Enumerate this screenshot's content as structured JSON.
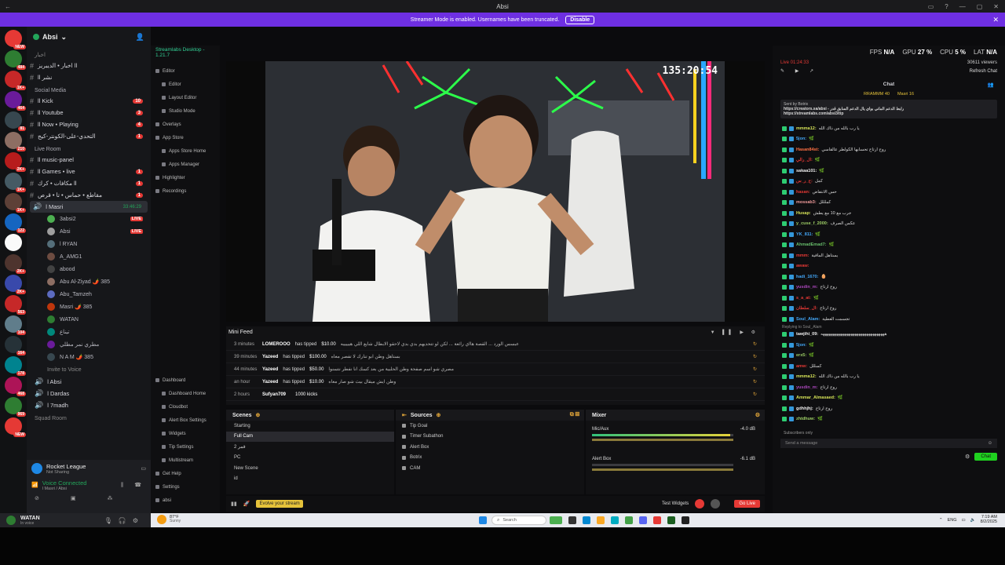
{
  "window": {
    "title": "Absi"
  },
  "banner": {
    "text": "Streamer Mode is enabled. Usernames have been truncated.",
    "button": "Disable"
  },
  "discord": {
    "server_name": "Absi",
    "servers": [
      {
        "color": "#e53935",
        "badge": "NEW"
      },
      {
        "color": "#2e7d32",
        "badge": "484"
      },
      {
        "color": "#c62828",
        "badge": "1K+"
      },
      {
        "color": "#6a1b9a",
        "badge": "464"
      },
      {
        "color": "#37474f",
        "badge": "81"
      },
      {
        "color": "#8d6e63",
        "badge": "210"
      },
      {
        "color": "#b71c1c",
        "badge": "2K+"
      },
      {
        "color": "#455a64",
        "badge": "1K+"
      },
      {
        "color": "#5d4037",
        "badge": "1K+"
      },
      {
        "color": "#1565c0",
        "badge": "122"
      },
      {
        "color": "#fafafa",
        "badge": ""
      },
      {
        "color": "#4e342e",
        "badge": "2K+"
      },
      {
        "color": "#3949ab",
        "badge": "2K+"
      },
      {
        "color": "#c62828",
        "badge": "563"
      },
      {
        "color": "#607d8b",
        "badge": "104"
      },
      {
        "color": "#263238",
        "badge": "164"
      },
      {
        "color": "#00838f",
        "badge": "178"
      },
      {
        "color": "#ad1457",
        "badge": "468"
      },
      {
        "color": "#2e7d32",
        "badge": "969"
      },
      {
        "color": "#e53935",
        "badge": "NEW"
      }
    ],
    "category_1": "اخبار",
    "channels_top": [
      {
        "name": "اخبار • الديبريز ll",
        "badge": ""
      },
      {
        "name": "ll نشر",
        "badge": ""
      }
    ],
    "category_social": "Social Media",
    "channels_social": [
      {
        "name": "ll Kick",
        "badge": "10"
      },
      {
        "name": "ll Youtube",
        "badge": "3"
      },
      {
        "name": "ll Now • Playing",
        "badge": "4"
      },
      {
        "name": "التحدي-على-الكونتر-كيج",
        "badge": "1"
      }
    ],
    "category_live": "Live Room",
    "channels_live": [
      {
        "name": "ll music-panel",
        "badge": ""
      },
      {
        "name": "ll Games • live",
        "badge": "1"
      },
      {
        "name": "مكافات • كرك ll",
        "badge": "1"
      },
      {
        "name": "مقاطع • حماس • تا • قرص",
        "badge": "1"
      }
    ],
    "voice_channel": {
      "name": "l Masri",
      "time": "33:46:29"
    },
    "voice_users": [
      {
        "name": "3absi2",
        "live": "LIVE",
        "color": "#4caf50"
      },
      {
        "name": "Absi",
        "live": "LIVE",
        "color": "#9e9e9e"
      },
      {
        "name": "l RYAN",
        "live": "",
        "color": "#546e7a"
      },
      {
        "name": "A_AMG1",
        "live": "",
        "color": "#6d4c41"
      },
      {
        "name": "abood",
        "live": "",
        "color": "#424242"
      },
      {
        "name": "Abu Al-Ziyad 🌶️ 385",
        "live": "",
        "color": "#8d6e63"
      },
      {
        "name": "Abu_Tamzeh",
        "live": "",
        "color": "#5c6bc0"
      },
      {
        "name": "Masri 🌶️ 385",
        "live": "",
        "color": "#bf360c"
      },
      {
        "name": "WATAN",
        "live": "",
        "color": "#2e7d32"
      },
      {
        "name": "تيناع",
        "live": "",
        "color": "#00897b"
      },
      {
        "name": "مطري نمر مطلي",
        "live": "",
        "color": "#6a1b9a"
      },
      {
        "name": "N A M 🌶️ 385",
        "live": "",
        "color": "#37474f"
      }
    ],
    "invite": "Invite to Voice",
    "voice_more": [
      {
        "name": "l Absi"
      },
      {
        "name": "l Dardas"
      },
      {
        "name": "l 7madh"
      }
    ],
    "category_squad": "Squad Room",
    "activity": {
      "title": "Rocket League",
      "sub": "Not Sharing"
    },
    "voice_status": {
      "title": "Voice Connected",
      "sub": "l Masri / Absi"
    },
    "user": {
      "name": "WATAN",
      "status": "In voice"
    }
  },
  "streamlabs": {
    "title": "Streamlabs Desktop - 1.21.7",
    "nav": [
      {
        "label": "Editor",
        "type": "head"
      },
      {
        "label": "Editor",
        "type": "sub"
      },
      {
        "label": "Layout Editor",
        "type": "sub"
      },
      {
        "label": "Studio Mode",
        "type": "sub"
      },
      {
        "label": "Overlays",
        "type": "head"
      },
      {
        "label": "App Store",
        "type": "head"
      },
      {
        "label": "Apps Store Home",
        "type": "sub"
      },
      {
        "label": "Apps Manager",
        "type": "sub"
      },
      {
        "label": "Highlighter",
        "type": "head"
      },
      {
        "label": "Recordings",
        "type": "head"
      }
    ],
    "nav_bottom": [
      {
        "label": "Dashboard",
        "type": "head"
      },
      {
        "label": "Dashboard Home",
        "type": "sub"
      },
      {
        "label": "Cloudbot",
        "type": "sub"
      },
      {
        "label": "Alert Box Settings",
        "type": "sub"
      },
      {
        "label": "Widgets",
        "type": "sub"
      },
      {
        "label": "Tip Settings",
        "type": "sub"
      },
      {
        "label": "Multistream",
        "type": "sub"
      },
      {
        "label": "Get Help",
        "type": "head"
      },
      {
        "label": "Settings",
        "type": "head"
      },
      {
        "label": "absi",
        "type": "head"
      }
    ],
    "timer": "135:20:54",
    "minifeed": {
      "title": "Mini Feed",
      "rows": [
        {
          "time": "3 minutes",
          "name": "LOMEROOO",
          "action": "has tipped",
          "amount": "$10.00",
          "msg": "عبسس الورد ... القصة هااي رائعة ... لكن لو تتحديهم بدي بدي لاحقو الابطال شايع اللي هيييييه"
        },
        {
          "time": "39 minutes",
          "name": "Yazeed",
          "action": "has tipped",
          "amount": "$100.00",
          "msg": "بستاهل وطن ابو تنارك لا تفصر معاه"
        },
        {
          "time": "44 minutes",
          "name": "Yazeed",
          "action": "has tipped",
          "amount": "$50.00",
          "msg": "مصري شو اسم صفحة وطن الحلبية من بعد كسك انا نفطر نتسنوا"
        },
        {
          "time": "an hour",
          "name": "Yazeed",
          "action": "has tipped",
          "amount": "$10.00",
          "msg": "وطن ايش ميقال بيث شو صار معاه"
        },
        {
          "time": "2 hours",
          "name": "Sufyan709",
          "action": "",
          "amount": "1000 kicks",
          "msg": ""
        }
      ]
    },
    "scenes": {
      "title": "Scenes",
      "items": [
        "Starting",
        "Full Cam",
        "2 قمر",
        "PC",
        "New Scene",
        "id"
      ]
    },
    "sources": {
      "title": "Sources",
      "items": [
        "Tip Goal",
        "Timer Subathon",
        "Alert Box",
        "Botrix",
        "CAM"
      ]
    },
    "mixer": {
      "title": "Mixer",
      "items": [
        {
          "name": "Mic/Aux",
          "db": "-4.0 dB",
          "level": 0.98
        },
        {
          "name": "Alert Box",
          "db": "-6.1 dB",
          "level": 0.0
        }
      ]
    },
    "bottom": {
      "promo": "Evolve your stream",
      "test": "Test Widgets",
      "golive": "Go Live"
    },
    "stats": {
      "fps_label": "FPS",
      "fps": "N/A",
      "gpu_label": "GPU",
      "gpu": "27 %",
      "cpu_label": "CPU",
      "cpu": "5 %",
      "lat_label": "LAT",
      "lat": "N/A"
    },
    "live": {
      "time": "Live 01:24:33",
      "viewers": "30611 viewers",
      "refresh": "Refresh Chat"
    },
    "chat": {
      "title": "Chat",
      "top_users": [
        "RRAMMM 40",
        "Masri 16"
      ],
      "pinned_by": "Sent by Botrix",
      "pinned_text": "https://creators.sa/absi - رابط الدعم الماني بواي يال الدعم السابق قدر",
      "pinned_link": "https://streamlabs.com/absi3/tip",
      "messages": [
        {
          "user": "mmma12:",
          "text": "يا رب بالله من ذاك الله",
          "color": "#d4e157"
        },
        {
          "user": "5jon:",
          "text": "🌿",
          "color": "#42a5f5"
        },
        {
          "user": "Hasan84st:",
          "text": "روح ارتاح تحسابها الكولطر عالقاسي",
          "color": "#ff7043"
        },
        {
          "user": "ال_رالي:",
          "text": "🌿",
          "color": "#e53935"
        },
        {
          "user": "sakaa101:",
          "text": "🌿",
          "color": "#eeeeee"
        },
        {
          "user": "ح_ر_س:",
          "text": "كمل",
          "color": "#e53935"
        },
        {
          "user": "hasan:",
          "text": "حس الانتفاض",
          "color": "#e53935"
        },
        {
          "user": "mossab3:",
          "text": "كملللل",
          "color": "#ef9a9a"
        },
        {
          "user": "Husap:",
          "text": "جرب مع 10 مع يطش",
          "color": "#d4e157"
        },
        {
          "user": "y_cuse_f_2000:",
          "text": "عكس الصرف",
          "color": "#9ccc65"
        },
        {
          "user": "YK_811:",
          "text": "🌿",
          "color": "#42a5f5"
        },
        {
          "user": "AhmadEmad7:",
          "text": "🌿",
          "color": "#66bb6a"
        },
        {
          "user": "mmm:",
          "text": "يستاهل المافية",
          "color": "#e53935"
        },
        {
          "user": "awaw:",
          "text": "",
          "color": "#e53935"
        },
        {
          "user": "hadi_1670:",
          "text": "🥚",
          "color": "#42a5f5"
        },
        {
          "user": "yusdin_m:",
          "text": "روح ارتاح",
          "color": "#ab47bc"
        },
        {
          "user": "s_a_at:",
          "text": "🌿",
          "color": "#e53935"
        },
        {
          "user": "ال_سلطان:",
          "text": "روح ارتاح",
          "color": "#e53935"
        },
        {
          "user": "Soul_Alam:",
          "text": "تجسمت العطية",
          "color": "#42a5f5"
        },
        {
          "user": "tawjihi_09:",
          "text": "ههههههههههههههههههههههههههههههههه",
          "color": "#eeeeee"
        },
        {
          "user": "5jon:",
          "text": "🌿",
          "color": "#42a5f5"
        },
        {
          "user": "erx5:",
          "text": "🌿",
          "color": "#9ccc65"
        },
        {
          "user": "amw:",
          "text": "كسللل",
          "color": "#e53935"
        },
        {
          "user": "mmma12:",
          "text": "يا رب بالله من ذاك الله",
          "color": "#d4e157"
        },
        {
          "user": "yusdin_m:",
          "text": "روح ارتاح",
          "color": "#ab47bc"
        },
        {
          "user": "Ammar_Almasaed:",
          "text": "🌿",
          "color": "#d4e157"
        },
        {
          "user": "gdhhjhj:",
          "text": "روح ارتاح",
          "color": "#eeeeee"
        },
        {
          "user": "zhtdhuw:",
          "text": "🌿",
          "color": "#9ccc65"
        }
      ],
      "reply_note": "Replying to Soul_Alam",
      "subs_only": "Subscribers only",
      "placeholder": "Send a message",
      "chat_btn": "Chat"
    }
  },
  "taskbar": {
    "weather_temp": "87°F",
    "weather_sub": "Sunny",
    "search": "Search",
    "lang": "ENG",
    "time": "7:19 AM",
    "date": "8/2/2025"
  }
}
